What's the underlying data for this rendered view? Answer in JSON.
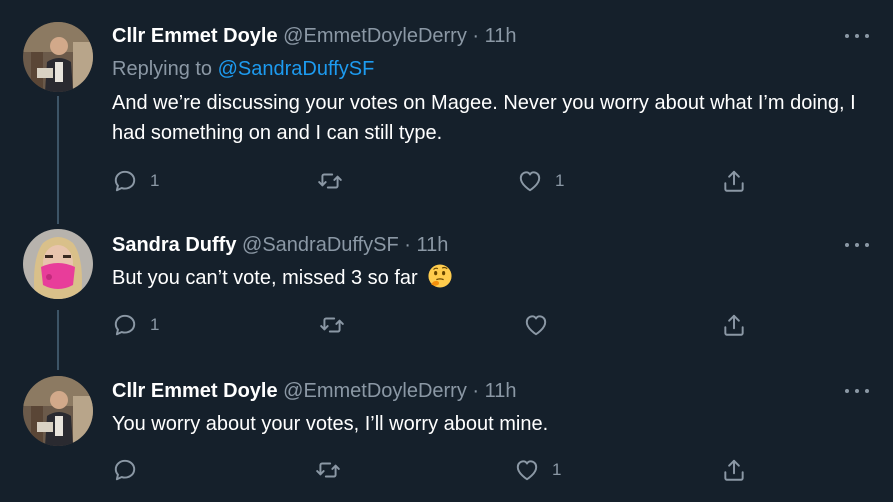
{
  "tweets": [
    {
      "name": "Cllr Emmet Doyle",
      "handle": "@EmmetDoyleDerry",
      "sep": "·",
      "time": "11h",
      "replying_prefix": "Replying to",
      "replying_handle": "@SandraDuffySF",
      "text": "And we’re discussing your votes on Magee.  Never you worry about what I’m doing, I had something on and I can still type.",
      "reply_count": "1",
      "retweet_count": "",
      "like_count": "1"
    },
    {
      "name": "Sandra Duffy",
      "handle": "@SandraDuffySF",
      "sep": "·",
      "time": "11h",
      "text": "But you can’t vote, missed 3 so far",
      "emoji": "thinking-face-icon",
      "reply_count": "1",
      "retweet_count": "",
      "like_count": ""
    },
    {
      "name": "Cllr Emmet Doyle",
      "handle": "@EmmetDoyleDerry",
      "sep": "·",
      "time": "11h",
      "text": "You worry about your votes, I’ll worry about mine.",
      "reply_count": "",
      "retweet_count": "",
      "like_count": "1"
    }
  ],
  "colors": {
    "background": "#15202b",
    "secondary_text": "#8b98a5",
    "link": "#1d9bf0",
    "thread_line": "#3d5466"
  }
}
